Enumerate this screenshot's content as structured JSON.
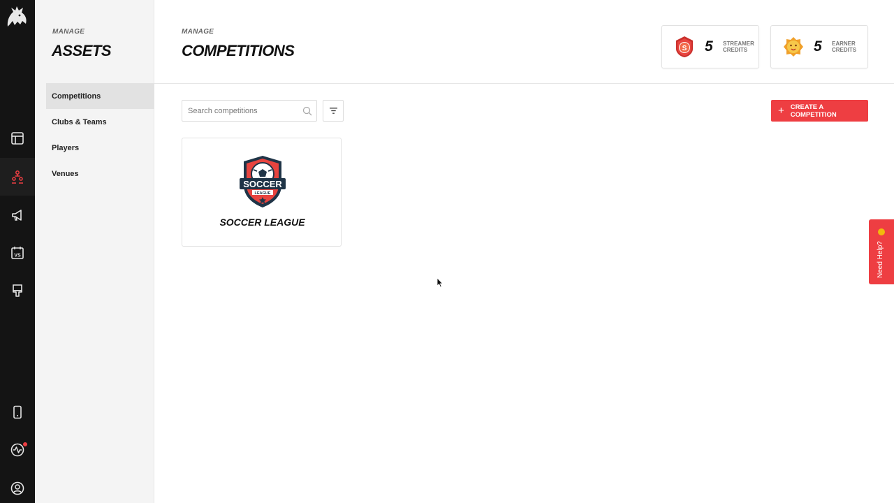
{
  "rail": {
    "icons": [
      "lion-logo-icon",
      "layout-icon",
      "assets-icon",
      "megaphone-icon",
      "calendar-vs-icon",
      "brush-icon",
      "mobile-icon",
      "activity-icon",
      "account-icon"
    ],
    "active": "assets-icon",
    "notification_color": "#ee3e42"
  },
  "sidebar": {
    "kicker": "MANAGE",
    "title": "ASSETS",
    "items": [
      {
        "label": "Competitions",
        "active": true
      },
      {
        "label": "Clubs & Teams",
        "active": false
      },
      {
        "label": "Players",
        "active": false
      },
      {
        "label": "Venues",
        "active": false
      }
    ]
  },
  "header": {
    "kicker": "MANAGE",
    "title": "COMPETITIONS",
    "credits": [
      {
        "value": "5",
        "label_line1": "STREAMER",
        "label_line2": "CREDITS",
        "icon": "streamer-badge-icon"
      },
      {
        "value": "5",
        "label_line1": "EARNER",
        "label_line2": "CREDITS",
        "icon": "earner-lion-icon"
      }
    ]
  },
  "toolbar": {
    "search_placeholder": "Search competitions",
    "search_value": "",
    "create_label": "CREATE A COMPETITION",
    "accent": "#ee3e42"
  },
  "competitions": [
    {
      "name": "SOCCER LEAGUE",
      "logo_top": "SOCCER",
      "logo_bottom": "LEAGUE"
    }
  ],
  "help": {
    "label": "Need Help?"
  }
}
